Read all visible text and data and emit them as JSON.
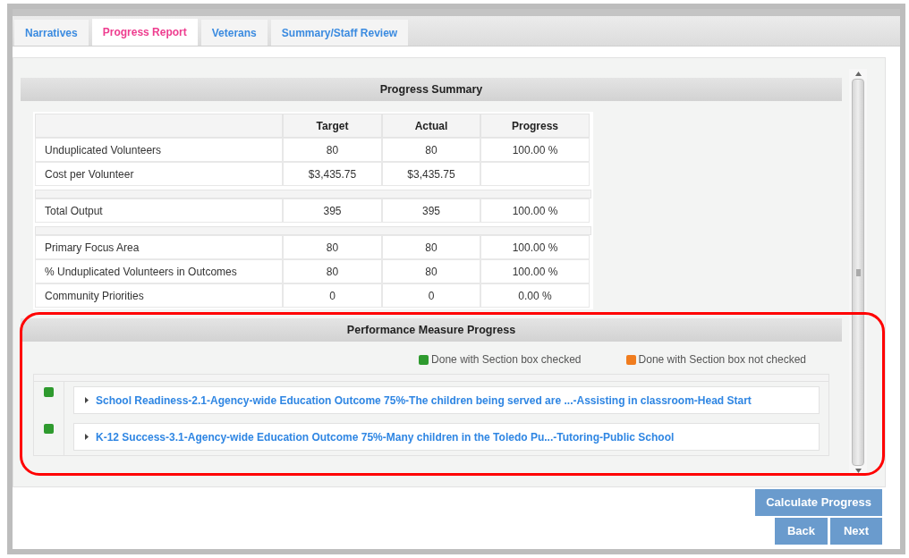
{
  "tabs": [
    {
      "label": "Narratives",
      "selected": false
    },
    {
      "label": "Progress Report",
      "selected": true
    },
    {
      "label": "Veterans",
      "selected": false
    },
    {
      "label": "Summary/Staff Review",
      "selected": false
    }
  ],
  "progress_summary": {
    "title": "Progress Summary",
    "columns": [
      "Target",
      "Actual",
      "Progress"
    ],
    "sections": [
      {
        "rows": [
          {
            "label": "Unduplicated Volunteers",
            "target": "80",
            "actual": "80",
            "progress": "100.00 %"
          },
          {
            "label": "Cost per Volunteer",
            "target": "$3,435.75",
            "actual": "$3,435.75"
          }
        ]
      },
      {
        "rows": [
          {
            "label": "Total Output",
            "target": "395",
            "actual": "395",
            "progress": "100.00 %"
          }
        ]
      },
      {
        "rows": [
          {
            "label": "Primary Focus Area",
            "target": "80",
            "actual": "80",
            "progress": "100.00 %"
          },
          {
            "label": "% Unduplicated Volunteers in Outcomes",
            "target": "80",
            "actual": "80",
            "progress": "100.00 %"
          },
          {
            "label": "Community Priorities",
            "target": "0",
            "actual": "0",
            "progress": "0.00 %"
          }
        ]
      }
    ]
  },
  "performance_measure_progress": {
    "title": "Performance Measure Progress",
    "legend": [
      {
        "label": "Done with Section box checked",
        "color": "#2e9a2e"
      },
      {
        "label": "Done with Section box not checked",
        "color": "#f07c1e"
      }
    ],
    "measures": [
      {
        "label": "School Readiness-2.1-Agency-wide Education Outcome 75%-The children being served are ...-Assisting in classroom-Head Start",
        "done": true
      },
      {
        "label": "K-12 Success-3.1-Agency-wide Education Outcome 75%-Many children in the Toledo Pu...-Tutoring-Public School",
        "done": true
      }
    ]
  },
  "buttons": {
    "calculate": "Calculate Progress",
    "back": "Back",
    "next": "Next"
  }
}
